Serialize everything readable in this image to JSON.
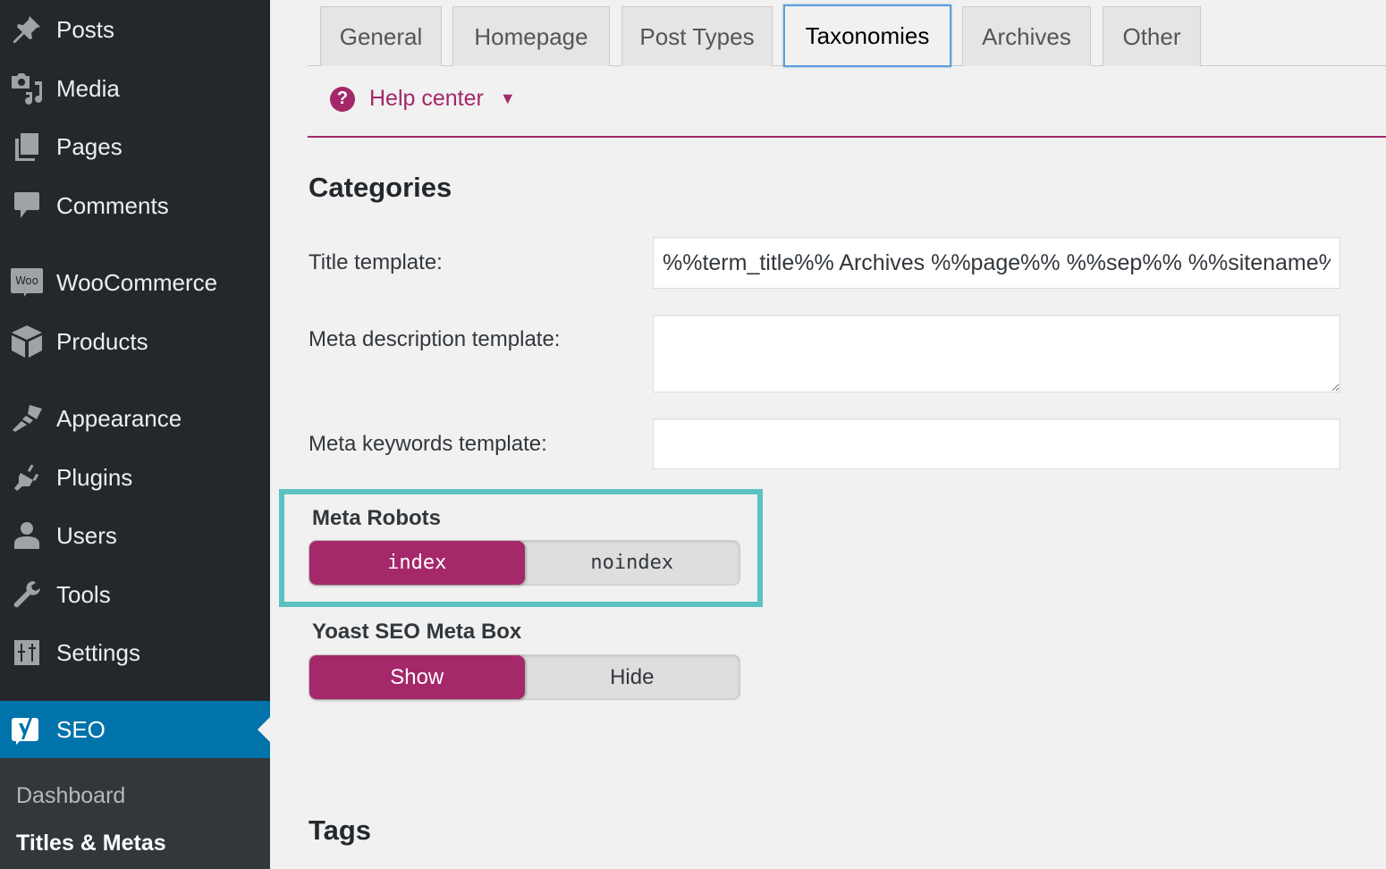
{
  "sidebar": {
    "items": [
      {
        "label": "Posts",
        "icon": "pin-icon"
      },
      {
        "label": "Media",
        "icon": "media-icon"
      },
      {
        "label": "Pages",
        "icon": "pages-icon"
      },
      {
        "label": "Comments",
        "icon": "comment-icon"
      },
      {
        "label": "WooCommerce",
        "icon": "woo-icon"
      },
      {
        "label": "Products",
        "icon": "box-icon"
      },
      {
        "label": "Appearance",
        "icon": "brush-icon"
      },
      {
        "label": "Plugins",
        "icon": "plug-icon"
      },
      {
        "label": "Users",
        "icon": "user-icon"
      },
      {
        "label": "Tools",
        "icon": "wrench-icon"
      },
      {
        "label": "Settings",
        "icon": "sliders-icon"
      },
      {
        "label": "SEO",
        "icon": "yoast-icon"
      }
    ],
    "woo_badge": "Woo",
    "submenu": [
      {
        "label": "Dashboard"
      },
      {
        "label": "Titles & Metas"
      }
    ]
  },
  "tabs": [
    {
      "label": "General"
    },
    {
      "label": "Homepage"
    },
    {
      "label": "Post Types"
    },
    {
      "label": "Taxonomies"
    },
    {
      "label": "Archives"
    },
    {
      "label": "Other"
    }
  ],
  "active_tab": "Taxonomies",
  "help": {
    "icon_glyph": "?",
    "label": "Help center",
    "caret": "▼"
  },
  "categories": {
    "title": "Categories",
    "title_template_label": "Title template:",
    "title_template_value": "%%term_title%% Archives %%page%% %%sep%% %%sitename%%",
    "meta_desc_label": "Meta description template:",
    "meta_desc_value": "",
    "meta_keywords_label": "Meta keywords template:",
    "meta_keywords_value": "",
    "meta_robots": {
      "label": "Meta Robots",
      "options": [
        "index",
        "noindex"
      ],
      "selected": "index"
    },
    "meta_box": {
      "label": "Yoast SEO Meta Box",
      "options": [
        "Show",
        "Hide"
      ],
      "selected": "Show"
    }
  },
  "tags": {
    "title": "Tags"
  },
  "colors": {
    "sidebar_bg": "#23282d",
    "active_menu": "#0073aa",
    "brand": "#a4286a",
    "highlight": "#5cc1c1"
  }
}
